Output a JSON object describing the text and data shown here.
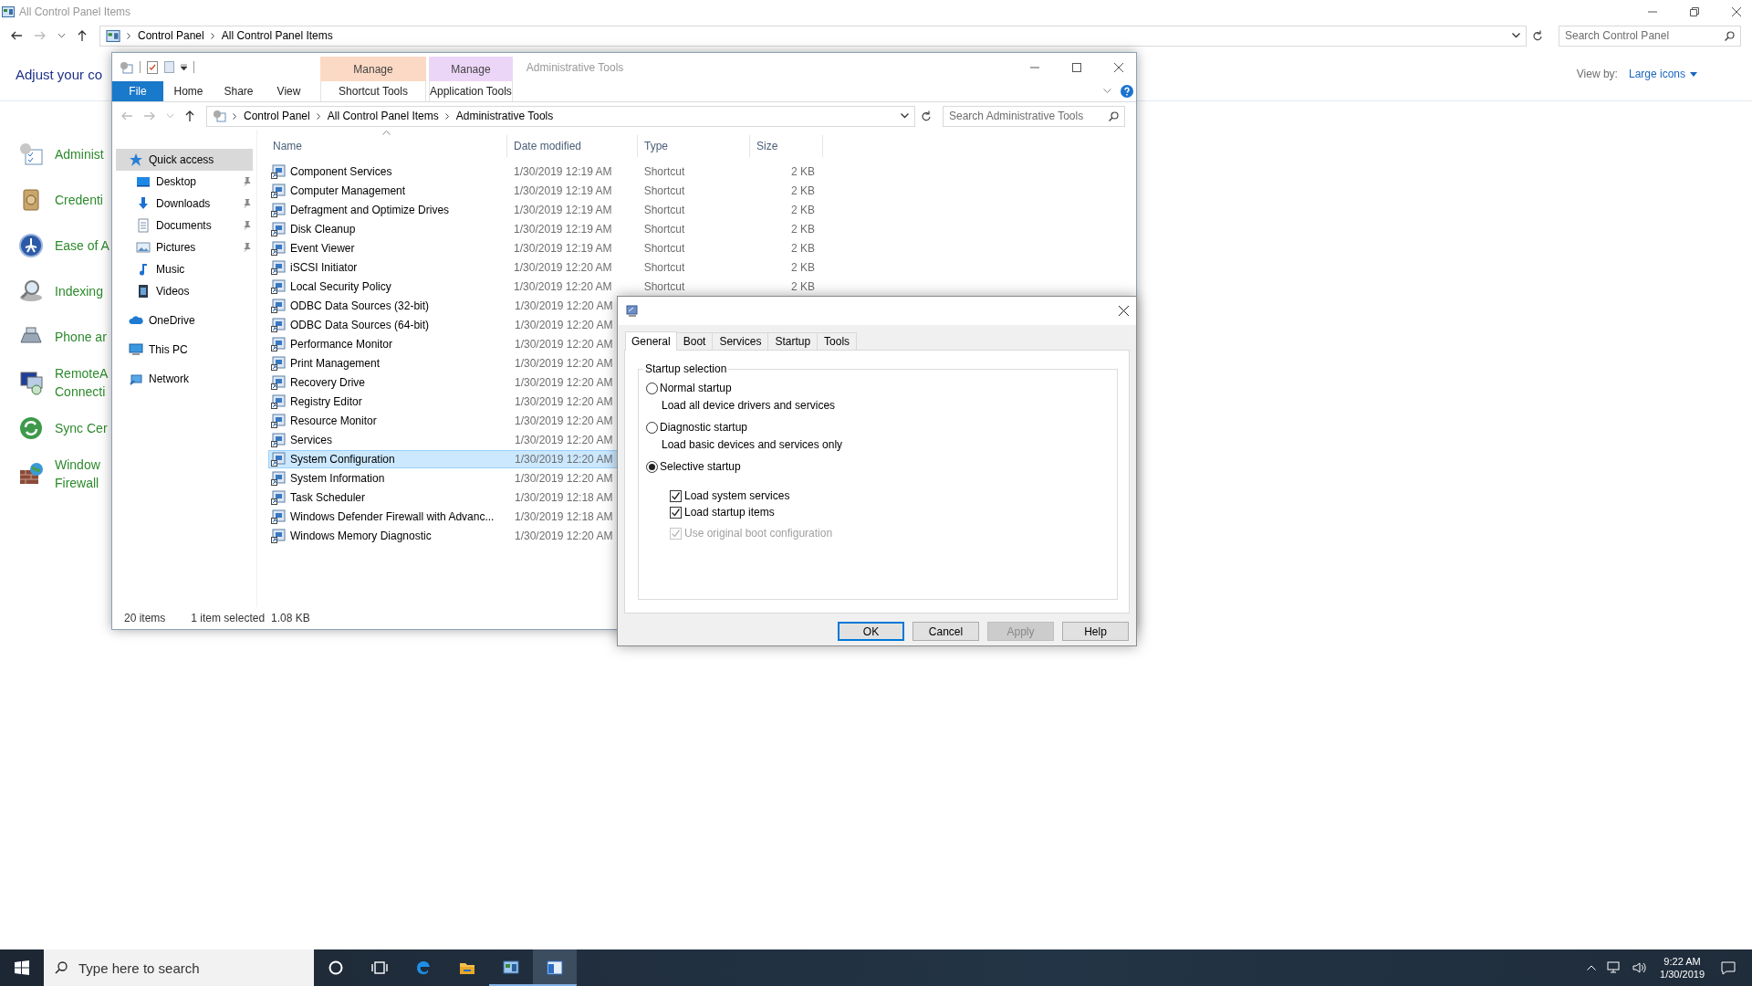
{
  "background_window": {
    "title": "All Control Panel Items",
    "breadcrumb": [
      "Control Panel",
      "All Control Panel Items"
    ],
    "search": {
      "placeholder": "Search Control Panel"
    },
    "heading": "Adjust your co",
    "view_by_label": "View by:",
    "view_by_value": "Large icons",
    "items": [
      {
        "kind": "tools",
        "lines": [
          "Administ"
        ]
      },
      {
        "kind": "vault",
        "lines": [
          "Credenti"
        ]
      },
      {
        "kind": "access",
        "lines": [
          "Ease of A"
        ]
      },
      {
        "kind": "indexing",
        "lines": [
          "Indexing"
        ]
      },
      {
        "kind": "phone",
        "lines": [
          "Phone ar"
        ]
      },
      {
        "kind": "remote",
        "lines": [
          "RemoteA",
          "Connecti"
        ]
      },
      {
        "kind": "sync",
        "lines": [
          "Sync Cer"
        ]
      },
      {
        "kind": "firewall",
        "lines": [
          "Window",
          "Firewall"
        ]
      }
    ]
  },
  "explorer": {
    "title": "Administrative Tools",
    "context_groups": [
      {
        "header": "Manage",
        "tab": "Shortcut Tools",
        "color": "#fcd9c4"
      },
      {
        "header": "Manage",
        "tab": "Application Tools",
        "color": "#ecd6f8"
      }
    ],
    "ribbon_tabs": [
      {
        "label": "File",
        "kind": "file"
      },
      {
        "label": "Home",
        "kind": "tab"
      },
      {
        "label": "Share",
        "kind": "tab"
      },
      {
        "label": "View",
        "kind": "tab"
      }
    ],
    "breadcrumb": [
      "Control Panel",
      "All Control Panel Items",
      "Administrative Tools"
    ],
    "search": {
      "placeholder": "Search Administrative Tools"
    },
    "nav": [
      {
        "label": "Quick access",
        "kind": "star",
        "selected": true,
        "children": [
          {
            "label": "Desktop",
            "kind": "desktop",
            "selected": false,
            "pinned": true
          },
          {
            "label": "Downloads",
            "kind": "download",
            "selected": false,
            "pinned": true
          },
          {
            "label": "Documents",
            "kind": "document",
            "selected": false,
            "pinned": true
          },
          {
            "label": "Pictures",
            "kind": "pictures",
            "selected": false,
            "pinned": true
          },
          {
            "label": "Music",
            "kind": "music",
            "selected": false,
            "pinned": false
          },
          {
            "label": "Videos",
            "kind": "videos",
            "selected": false,
            "pinned": false
          }
        ]
      },
      {
        "label": "OneDrive",
        "kind": "cloud",
        "selected": false
      },
      {
        "label": "This PC",
        "kind": "pc",
        "selected": false
      },
      {
        "label": "Network",
        "kind": "network",
        "selected": false
      }
    ],
    "columns": [
      "Name",
      "Date modified",
      "Type",
      "Size"
    ],
    "files": [
      {
        "name": "Component Services",
        "date": "1/30/2019 12:19 AM",
        "type": "Shortcut",
        "size": "2 KB",
        "selected": false
      },
      {
        "name": "Computer Management",
        "date": "1/30/2019 12:19 AM",
        "type": "Shortcut",
        "size": "2 KB",
        "selected": false
      },
      {
        "name": "Defragment and Optimize Drives",
        "date": "1/30/2019 12:19 AM",
        "type": "Shortcut",
        "size": "2 KB",
        "selected": false
      },
      {
        "name": "Disk Cleanup",
        "date": "1/30/2019 12:19 AM",
        "type": "Shortcut",
        "size": "2 KB",
        "selected": false
      },
      {
        "name": "Event Viewer",
        "date": "1/30/2019 12:19 AM",
        "type": "Shortcut",
        "size": "2 KB",
        "selected": false
      },
      {
        "name": "iSCSI Initiator",
        "date": "1/30/2019 12:20 AM",
        "type": "Shortcut",
        "size": "2 KB",
        "selected": false
      },
      {
        "name": "Local Security Policy",
        "date": "1/30/2019 12:20 AM",
        "type": "Shortcut",
        "size": "2 KB",
        "selected": false
      },
      {
        "name": "ODBC Data Sources (32-bit)",
        "date": "1/30/2019 12:20 AM",
        "selected": false
      },
      {
        "name": "ODBC Data Sources (64-bit)",
        "date": "1/30/2019 12:20 AM",
        "selected": false
      },
      {
        "name": "Performance Monitor",
        "date": "1/30/2019 12:20 AM",
        "selected": false
      },
      {
        "name": "Print Management",
        "date": "1/30/2019 12:20 AM",
        "selected": false
      },
      {
        "name": "Recovery Drive",
        "date": "1/30/2019 12:20 AM",
        "selected": false
      },
      {
        "name": "Registry Editor",
        "date": "1/30/2019 12:20 AM",
        "selected": false
      },
      {
        "name": "Resource Monitor",
        "date": "1/30/2019 12:20 AM",
        "selected": false
      },
      {
        "name": "Services",
        "date": "1/30/2019 12:20 AM",
        "selected": false
      },
      {
        "name": "System Configuration",
        "date": "1/30/2019 12:20 AM",
        "selected": true
      },
      {
        "name": "System Information",
        "date": "1/30/2019 12:20 AM",
        "selected": false
      },
      {
        "name": "Task Scheduler",
        "date": "1/30/2019 12:18 AM",
        "selected": false
      },
      {
        "name": "Windows Defender Firewall with Advanc...",
        "date": "1/30/2019 12:18 AM",
        "selected": false
      },
      {
        "name": "Windows Memory Diagnostic",
        "date": "1/30/2019 12:20 AM",
        "selected": false
      }
    ],
    "status": {
      "count": "20 items",
      "selection": "1 item selected",
      "size": "1.08 KB"
    }
  },
  "dialog": {
    "tabs": [
      {
        "label": "General",
        "selected": true
      },
      {
        "label": "Boot",
        "selected": false
      },
      {
        "label": "Services",
        "selected": false
      },
      {
        "label": "Startup",
        "selected": false
      },
      {
        "label": "Tools",
        "selected": false
      }
    ],
    "group_title": "Startup selection",
    "options": [
      {
        "label": "Normal startup",
        "description": "Load all device drivers and services",
        "selected": false
      },
      {
        "label": "Diagnostic startup",
        "description": "Load basic devices and services only",
        "selected": false
      },
      {
        "label": "Selective startup",
        "selected": true
      }
    ],
    "checkboxes": [
      {
        "label": "Load system services",
        "checked": true,
        "disabled": false
      },
      {
        "label": "Load startup items",
        "checked": true,
        "disabled": false
      },
      {
        "label": "Use original boot configuration",
        "checked": true,
        "disabled": true
      }
    ],
    "buttons": [
      {
        "label": "OK",
        "default": true,
        "disabled": false
      },
      {
        "label": "Cancel",
        "default": false,
        "disabled": false
      },
      {
        "label": "Apply",
        "default": false,
        "disabled": true
      },
      {
        "label": "Help",
        "default": false,
        "disabled": false
      }
    ]
  },
  "taskbar": {
    "search": {
      "placeholder": "Type here to search"
    },
    "apps": [
      {
        "kind": "cortana",
        "open": false,
        "selected": false
      },
      {
        "kind": "taskview",
        "open": false,
        "selected": false
      },
      {
        "kind": "edge",
        "open": false,
        "selected": false
      },
      {
        "kind": "explorer",
        "open": false,
        "selected": false
      },
      {
        "kind": "controlpanel",
        "open": true,
        "selected": false
      },
      {
        "kind": "msconfig",
        "open": true,
        "selected": true
      }
    ],
    "time": "9:22 AM",
    "date": "1/30/2019"
  }
}
